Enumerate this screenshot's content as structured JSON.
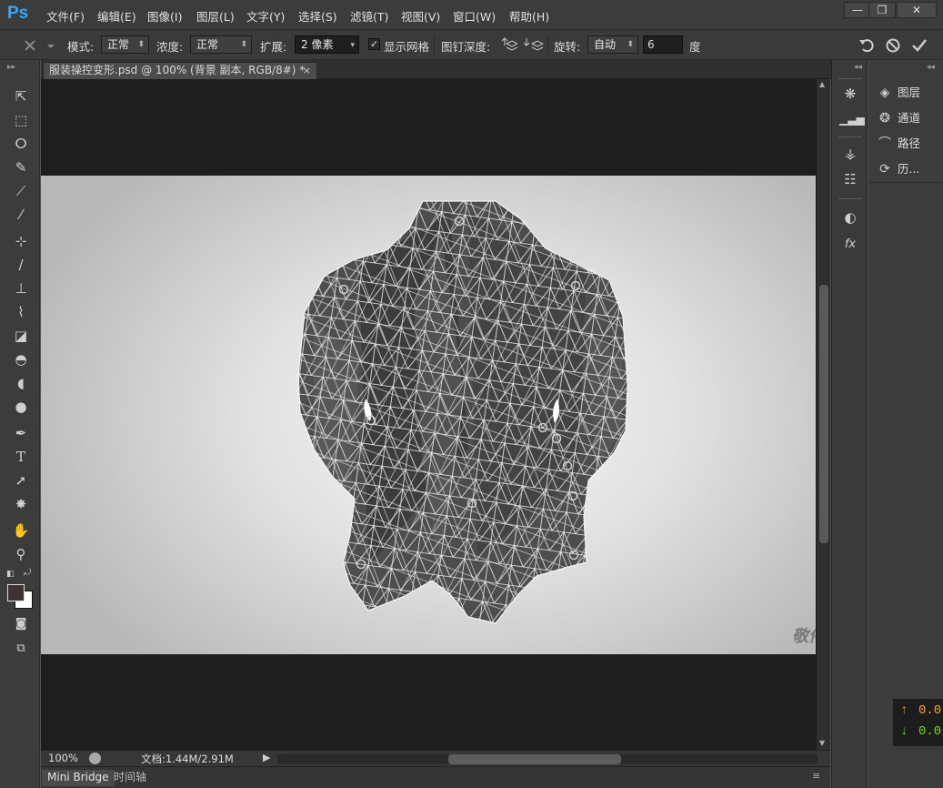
{
  "app": {
    "logo": "Ps"
  },
  "menu": [
    "文件(F)",
    "编辑(E)",
    "图像(I)",
    "图层(L)",
    "文字(Y)",
    "选择(S)",
    "滤镜(T)",
    "视图(V)",
    "窗口(W)",
    "帮助(H)"
  ],
  "window_controls": {
    "minimize": "—",
    "restore": "❐",
    "close": "✕"
  },
  "options": {
    "mode_label": "模式:",
    "mode_value": "正常",
    "density_label": "浓度:",
    "density_value": "正常",
    "expand_label": "扩展:",
    "expand_value": "2 像素",
    "show_mesh_checked": "✓",
    "show_mesh_label": "显示网格",
    "pin_depth_label": "图钉深度:",
    "rotate_label": "旋转:",
    "rotate_value": "自动",
    "angle_value": "6",
    "angle_unit": "度"
  },
  "document": {
    "tab_title": "服装操控变形.psd @ 100% (背景 副本, RGB/8#) *",
    "tab_close": "×",
    "watermark": "敬伟"
  },
  "status": {
    "zoom": "100%",
    "doc_info": "文档:1.44M/2.91M"
  },
  "bottom_tabs": [
    "Mini Bridge",
    "时间轴"
  ],
  "panels": [
    {
      "label": "图层",
      "icon": "layers-icon"
    },
    {
      "label": "通道",
      "icon": "channels-icon"
    },
    {
      "label": "路径",
      "icon": "paths-icon"
    },
    {
      "label": "历...",
      "icon": "history-icon"
    }
  ],
  "info_overlay": {
    "up_value": "0.0",
    "down_value": "0.0",
    "up_color": "#f5a623",
    "down_color": "#7ed321"
  }
}
